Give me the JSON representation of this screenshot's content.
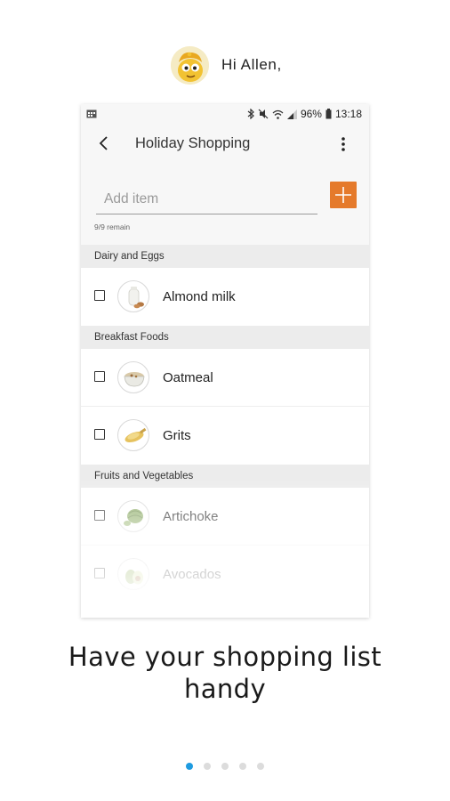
{
  "greeting": {
    "text": "Hi Allen,",
    "avatar_icon": "smiling-face-avatar"
  },
  "status_bar": {
    "left_icon": "calendar-icon",
    "icons": [
      "bluetooth-icon",
      "mute-icon",
      "wifi-icon",
      "signal-icon"
    ],
    "battery": "96%",
    "time": "13:18"
  },
  "app_bar": {
    "title": "Holiday Shopping",
    "back_icon": "back-arrow-icon",
    "more_icon": "more-vert-icon"
  },
  "add_item": {
    "placeholder": "Add item",
    "add_icon": "plus-icon",
    "accent_color": "#e57a2b"
  },
  "remain_text": "9/9 remain",
  "sections": [
    {
      "title": "Dairy and Eggs",
      "items": [
        {
          "name": "Almond milk",
          "icon": "almond-milk-icon"
        }
      ]
    },
    {
      "title": "Breakfast Foods",
      "items": [
        {
          "name": "Oatmeal",
          "icon": "oatmeal-bowl-icon"
        },
        {
          "name": "Grits",
          "icon": "grits-icon"
        }
      ]
    },
    {
      "title": "Fruits and Vegetables",
      "items": [
        {
          "name": "Artichoke",
          "icon": "artichoke-icon"
        },
        {
          "name": "Avocados",
          "icon": "avocado-icon"
        }
      ]
    }
  ],
  "headline": {
    "line1": "Have your shopping list",
    "line2": "handy"
  },
  "pager": {
    "pages": 5,
    "active_index": 0,
    "active_color": "#1e9be0"
  }
}
